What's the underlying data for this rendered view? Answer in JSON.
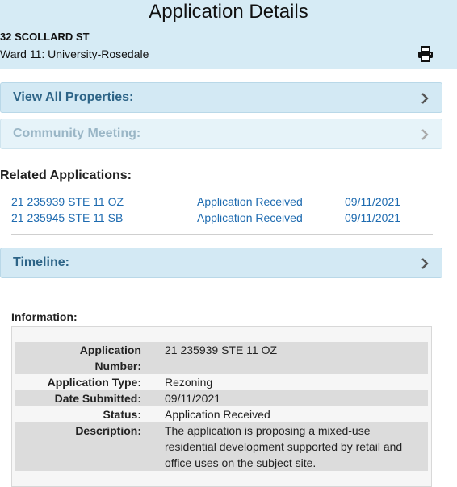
{
  "header": {
    "title": "Application Details",
    "address": "32 SCOLLARD ST",
    "ward": "Ward 11: University-Rosedale",
    "print_icon": "printer-icon"
  },
  "panels": {
    "view_all": "View All Properties:",
    "community": "Community Meeting:",
    "timeline": "Timeline:"
  },
  "related": {
    "title": "Related Applications:",
    "rows": [
      {
        "id": "21 235939 STE 11 OZ",
        "status": "Application Received",
        "date": "09/11/2021"
      },
      {
        "id": "21 235945 STE 11 SB",
        "status": "Application Received",
        "date": "09/11/2021"
      }
    ]
  },
  "info": {
    "title": "Information:",
    "app_number_label_1": "Application",
    "app_number_label_2": "Number:",
    "app_number": "21 235939 STE 11 OZ",
    "type_label": "Application Type:",
    "type": "Rezoning",
    "date_label": "Date Submitted:",
    "date": "09/11/2021",
    "status_label": "Status:",
    "status": "Application Received",
    "desc_label": "Description:",
    "desc_line_1": "The application is proposing a mixed-use",
    "desc_line_2": "residential development supported by retail and",
    "desc_line_3": "office uses on the subject site."
  },
  "colors": {
    "header_bg": "#d6ebf5",
    "panel_bg": "#d3e9f4",
    "panel_text": "#2d6487",
    "link": "#1e6bb0"
  }
}
